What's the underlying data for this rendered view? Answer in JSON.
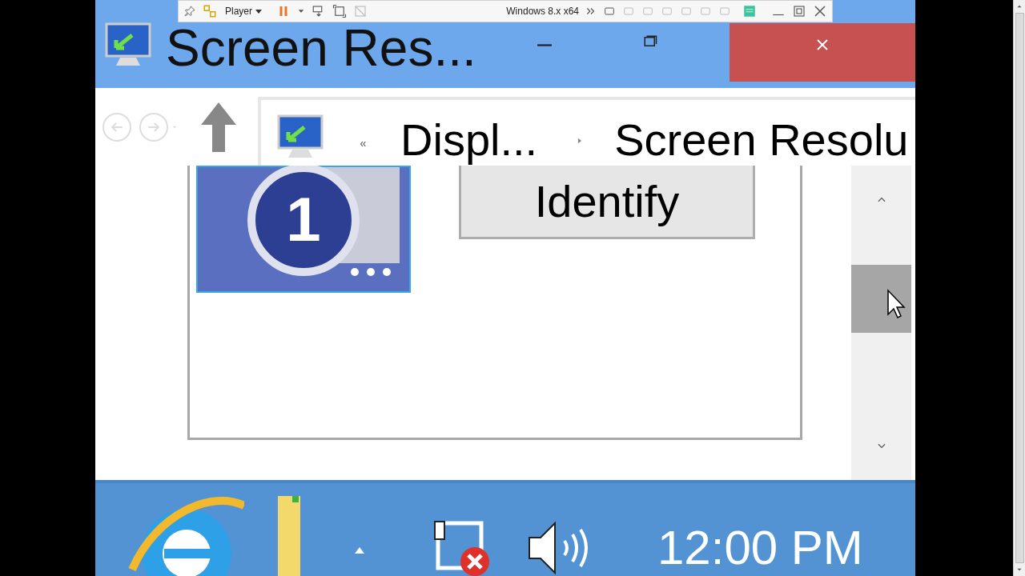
{
  "vm_toolbar": {
    "menu_label": "Player",
    "vm_name": "Windows 8.x x64"
  },
  "window": {
    "title": "Screen Res..."
  },
  "address_bar": {
    "breadcrumbs": [
      "Displ...",
      "Screen Resolu"
    ]
  },
  "display": {
    "monitor_number": "1",
    "identify_button": "Identify"
  },
  "taskbar": {
    "clock": "12:00 PM"
  }
}
